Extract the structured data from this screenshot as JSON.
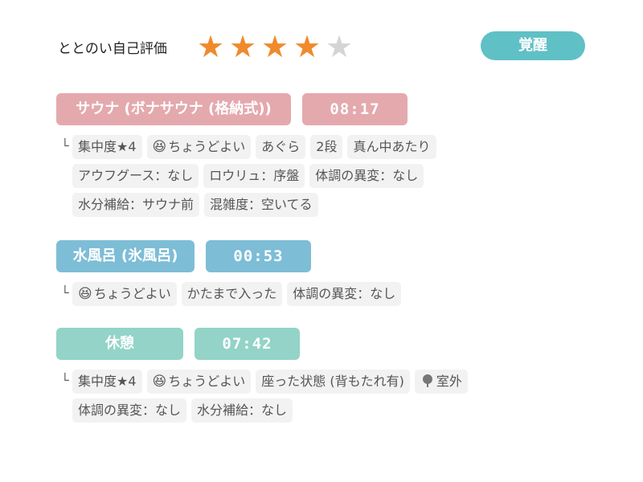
{
  "rating": {
    "label": "ととのい自己評価",
    "value": 4,
    "max": 5,
    "badge": "覚醒",
    "colors": {
      "star_on": "#f08a2c",
      "star_off": "#d4d4d4",
      "badge_bg": "#5fc0c6"
    }
  },
  "sauna": {
    "name": "サウナ (ボナサウナ (格納式))",
    "time": "08:17",
    "color": "#e4a9ad",
    "branch": "└",
    "tags_line1": [
      "集中度★4",
      "ちょうどよい",
      "あぐら",
      "2段",
      "真ん中あたり"
    ],
    "tags_line2": [
      "アウフグース：なし",
      "ロウリュ：序盤",
      "体調の異変：なし"
    ],
    "tags_line3": [
      "水分補給：サウナ前",
      "混雑度：空いてる"
    ],
    "emoji_icon": "grinning-squint-emoji"
  },
  "water": {
    "name": "水風呂 (氷風呂)",
    "time": "00:53",
    "color": "#7dbdd6",
    "branch": "└",
    "tags_line1": [
      "ちょうどよい",
      "かたまで入った",
      "体調の異変：なし"
    ],
    "emoji_icon": "grinning-squint-emoji"
  },
  "rest": {
    "name": "休憩",
    "time": "07:42",
    "color": "#93d3c8",
    "branch": "└",
    "tags_line1": [
      "集中度★4",
      "ちょうどよい",
      "座った状態 (背もたれ有)",
      "室外"
    ],
    "tags_line2": [
      "体調の異変：なし",
      "水分補給：なし"
    ],
    "emoji_icon": "grinning-squint-emoji",
    "tree_icon": "tree-icon"
  }
}
